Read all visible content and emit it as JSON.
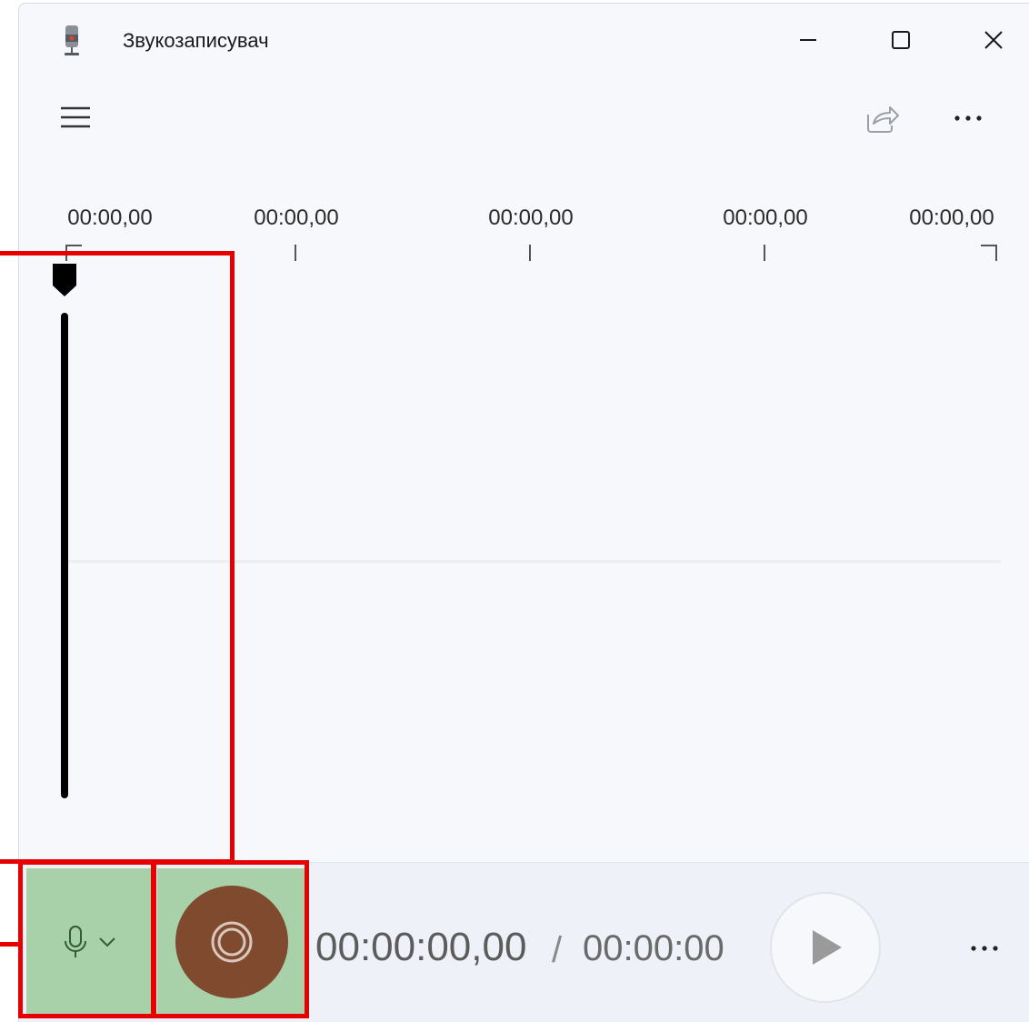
{
  "window": {
    "title": "Звукозаписувач"
  },
  "timeline": {
    "ticks": [
      "00:00,00",
      "00:00,00",
      "00:00,00",
      "00:00,00",
      "00:00,00"
    ]
  },
  "player": {
    "current_time": "00:00:00,00",
    "separator": "/",
    "total_time": "00:00:00"
  },
  "icons": {
    "app": "microphone-app-icon",
    "minimize": "minimize-icon",
    "maximize": "maximize-icon",
    "close": "close-icon",
    "menu": "hamburger-menu-icon",
    "share": "share-icon",
    "more": "more-icon",
    "mic": "microphone-icon",
    "chevron": "chevron-down-icon",
    "record": "record-icon",
    "play": "play-icon"
  },
  "colors": {
    "record_button": "#7f4a2e",
    "highlight_fill": "#a8d1aa",
    "highlight_border": "#e60000",
    "background": "#f6f8fc"
  }
}
